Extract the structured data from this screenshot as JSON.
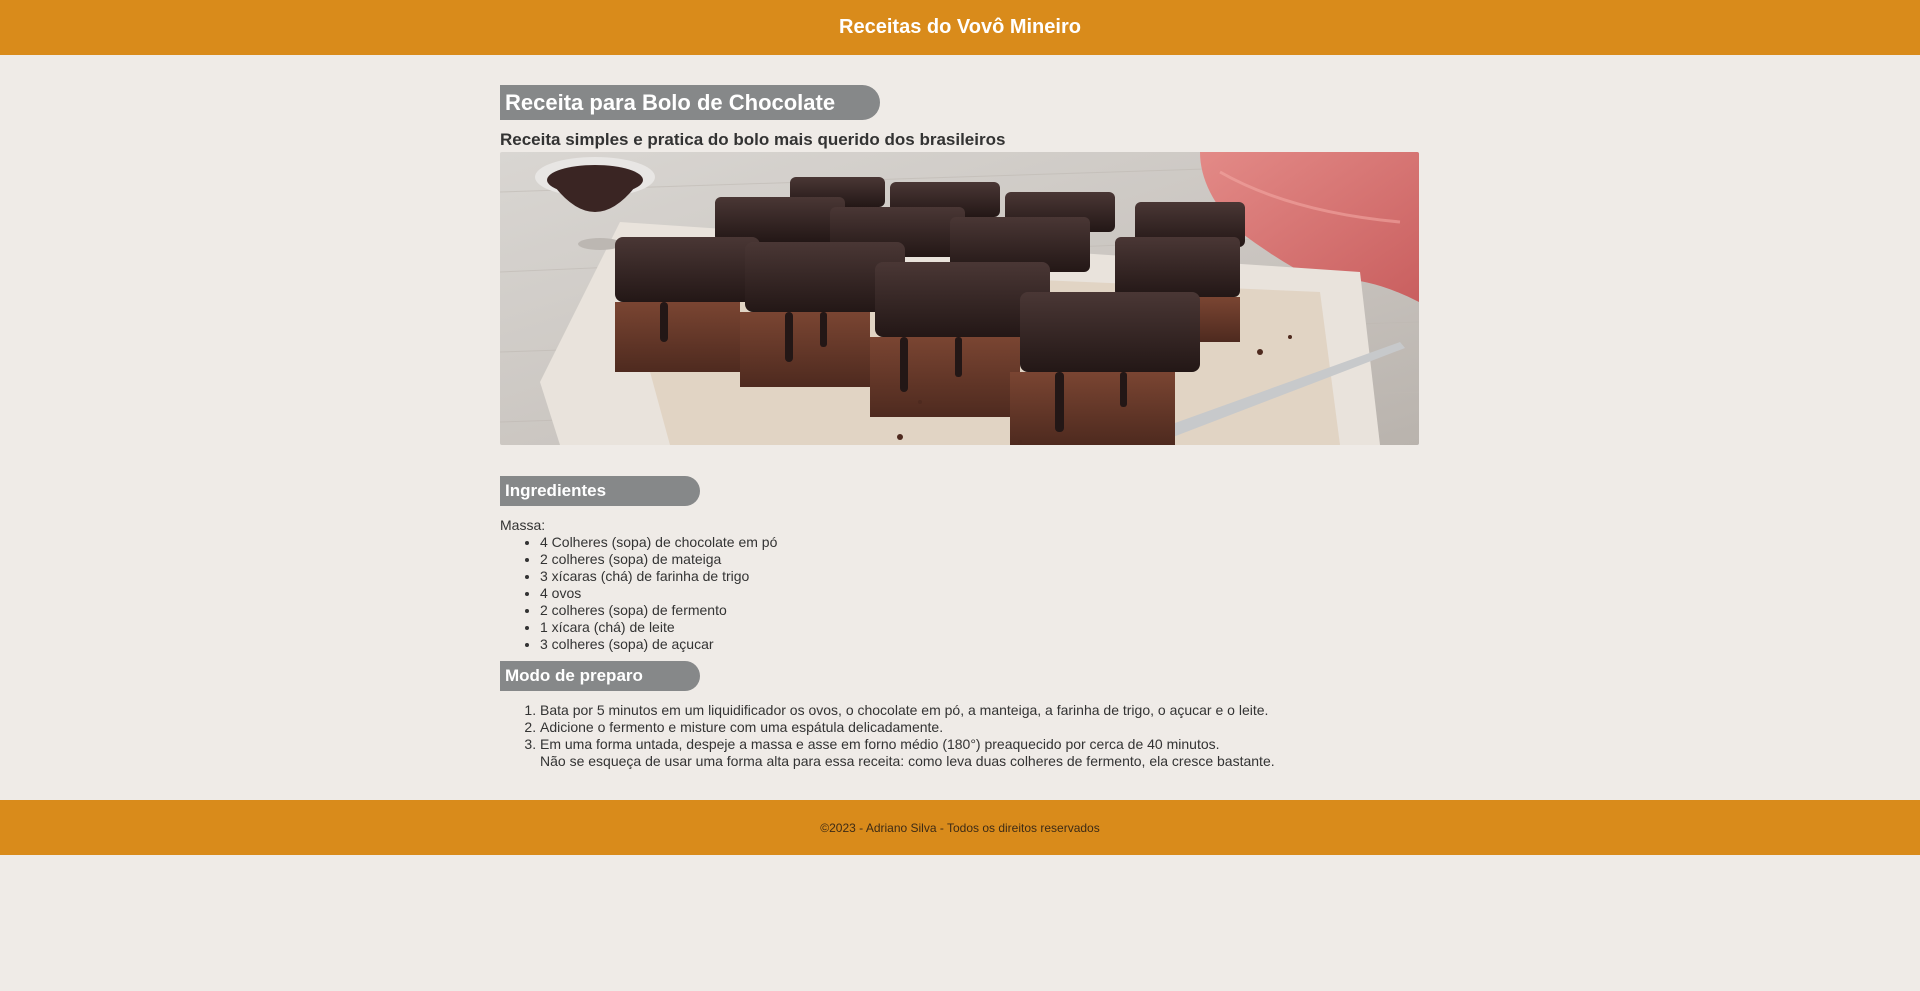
{
  "header": {
    "site_title": "Receitas do Vovô Mineiro"
  },
  "recipe": {
    "title": "Receita para Bolo de Chocolate",
    "subtitle": "Receita simples e pratica do bolo mais querido dos brasileiros"
  },
  "ingredients": {
    "heading": "Ingredientes",
    "group_label": "Massa:",
    "items": [
      "4 Colheres (sopa) de chocolate em pó",
      "2 colheres (sopa) de mateiga",
      "3 xícaras (chá) de farinha de trigo",
      "4 ovos",
      "2 colheres (sopa) de fermento",
      "1 xícara (chá) de leite",
      "3 colheres (sopa) de açucar"
    ]
  },
  "preparation": {
    "heading": "Modo de preparo",
    "steps": [
      "Bata por 5 minutos em um liquidificador os ovos, o chocolate em pó, a manteiga, a farinha de trigo, o açucar e o leite.",
      "Adicione o fermento e misture com uma espátula delicadamente.",
      "Em uma forma untada, despeje a massa e asse em forno médio (180°) preaquecido por cerca de 40 minutos."
    ],
    "note": "Não se esqueça de usar uma forma alta para essa receita: como leva duas colheres de fermento, ela cresce bastante."
  },
  "footer": {
    "copyright": "©2023 - Adriano Silva - Todos os direitos reservados"
  },
  "colors": {
    "header_bg": "#d98b1b",
    "page_bg": "#efebe7",
    "heading_pill_bg": "#868889"
  }
}
